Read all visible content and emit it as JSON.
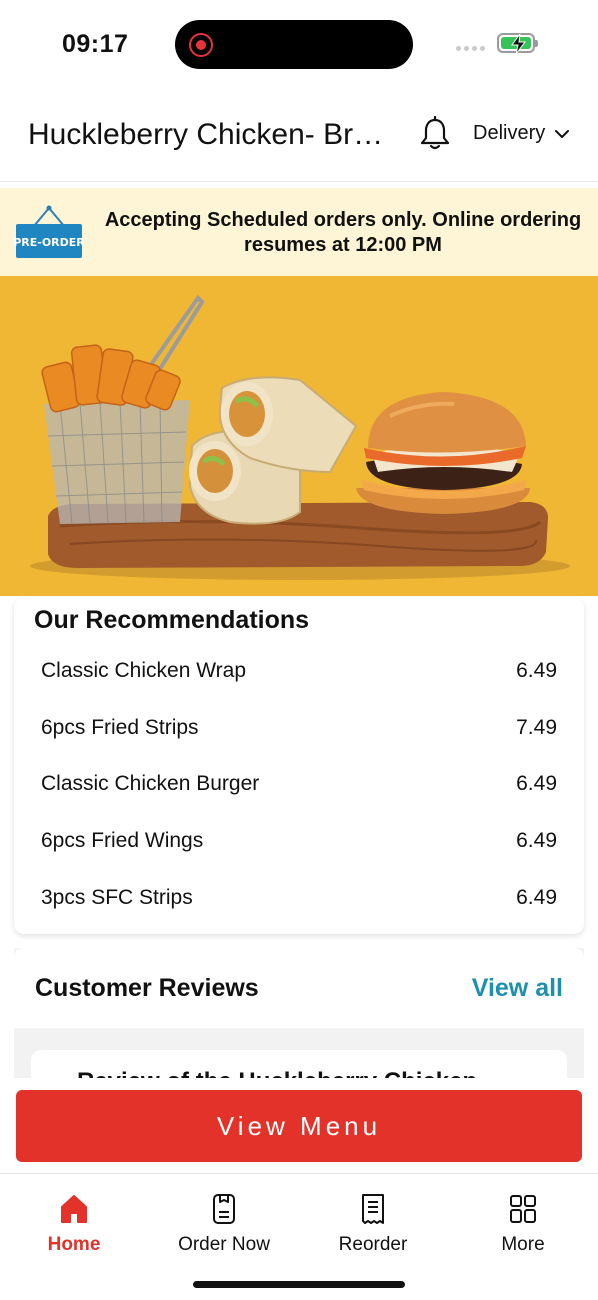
{
  "status_bar": {
    "time": "09:17"
  },
  "header": {
    "store_name": "Huckleberry Chicken- Brooklyn",
    "order_mode": "Delivery",
    "icons": [
      "bell-icon",
      "chevron-down-icon"
    ]
  },
  "banner": {
    "tag_label": "PRE-ORDER",
    "message": "Accepting Scheduled orders only. Online ordering resumes at 12:00 PM"
  },
  "recommendations": {
    "title": "Our Recommendations",
    "items": [
      {
        "name": "Classic Chicken Wrap",
        "price": "6.49"
      },
      {
        "name": "6pcs Fried Strips",
        "price": "7.49"
      },
      {
        "name": "Classic Chicken Burger",
        "price": "6.49"
      },
      {
        "name": "6pcs Fried Wings",
        "price": "6.49"
      },
      {
        "name": "3pcs SFC Strips",
        "price": "6.49"
      }
    ]
  },
  "reviews": {
    "title": "Customer Reviews",
    "view_all": "View all",
    "first_card_title": "Review of the Huckleberry Chicken"
  },
  "cta": {
    "view_menu": "View Menu"
  },
  "tabs": [
    {
      "label": "Home",
      "icon": "home-icon",
      "active": true
    },
    {
      "label": "Order Now",
      "icon": "order-icon",
      "active": false
    },
    {
      "label": "Reorder",
      "icon": "receipt-icon",
      "active": false
    },
    {
      "label": "More",
      "icon": "grid-icon",
      "active": false
    }
  ],
  "colors": {
    "brand_red": "#e3322a",
    "link_blue": "#1f8fb0",
    "hero_yellow": "#efb733",
    "banner_bg": "#fdf5d6"
  }
}
